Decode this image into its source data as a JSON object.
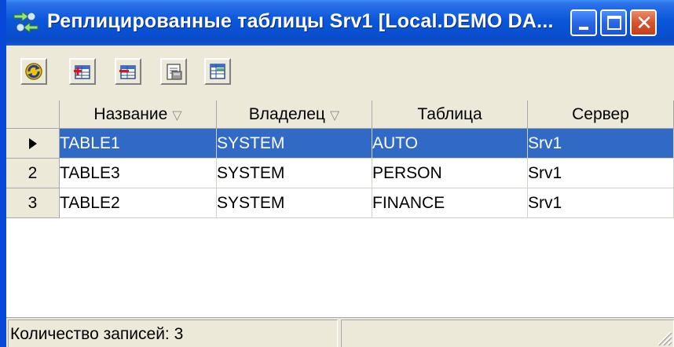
{
  "window": {
    "title": "Реплицированные таблицы Srv1 [Local.DEMO DA...",
    "colors": {
      "title_bar": "#0A56DA",
      "selection": "#316AC5",
      "frame": "#0848D8"
    }
  },
  "toolbar": {
    "buttons": [
      {
        "icon": "refresh-icon"
      },
      {
        "icon": "add-table-icon"
      },
      {
        "icon": "remove-table-icon"
      },
      {
        "icon": "properties-icon"
      },
      {
        "icon": "table-view-icon"
      }
    ]
  },
  "grid": {
    "columns": [
      {
        "label": "Название",
        "sorted": true
      },
      {
        "label": "Владелец",
        "sorted": true
      },
      {
        "label": "Таблица",
        "sorted": false
      },
      {
        "label": "Сервер",
        "sorted": false
      }
    ],
    "sort_glyph": "▽",
    "rows": [
      {
        "num": "",
        "name": "TABLE1",
        "owner": "SYSTEM",
        "table": "AUTO",
        "server": "Srv1",
        "selected": true
      },
      {
        "num": "2",
        "name": "TABLE3",
        "owner": "SYSTEM",
        "table": "PERSON",
        "server": "Srv1",
        "selected": false
      },
      {
        "num": "3",
        "name": "TABLE2",
        "owner": "SYSTEM",
        "table": "FINANCE",
        "server": "Srv1",
        "selected": false
      }
    ]
  },
  "status": {
    "records_text": "Количество записей: 3",
    "secondary_text": ""
  }
}
